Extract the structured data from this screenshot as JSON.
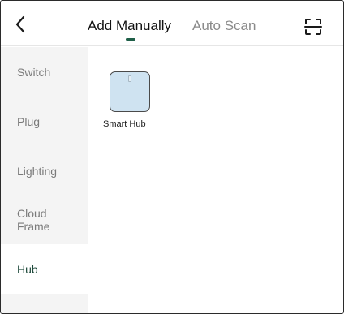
{
  "header": {
    "back_icon": "chevron-left-icon",
    "tabs": [
      {
        "label": "Add Manually",
        "active": true
      },
      {
        "label": "Auto Scan",
        "active": false
      }
    ],
    "scan_icon": "scan-frame-icon",
    "accent_color": "#1f5f48"
  },
  "sidebar": {
    "items": [
      {
        "label": "Switch",
        "active": false
      },
      {
        "label": "Plug",
        "active": false
      },
      {
        "label": "Lighting",
        "active": false
      },
      {
        "label": "Cloud Frame",
        "active": false
      },
      {
        "label": "Hub",
        "active": true
      }
    ]
  },
  "devices": [
    {
      "label": "Smart Hub",
      "icon": "smart-hub-icon"
    }
  ]
}
